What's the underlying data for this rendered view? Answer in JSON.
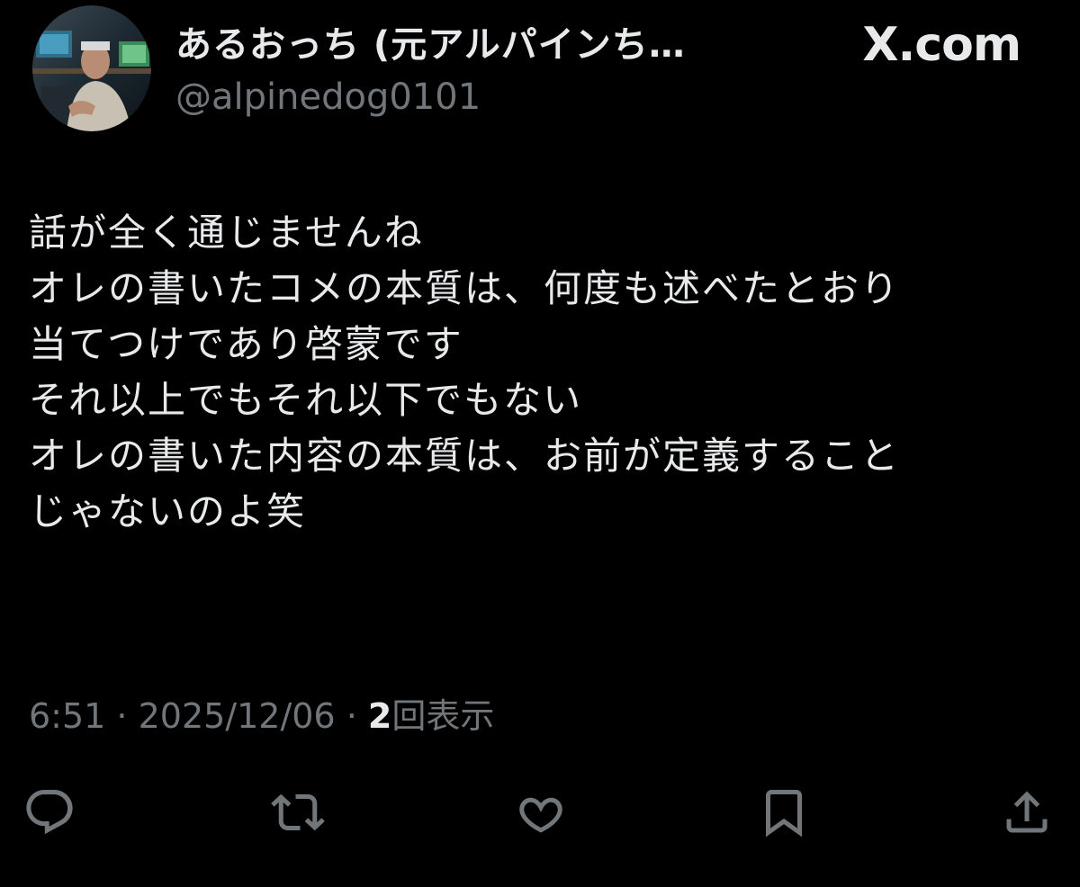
{
  "header": {
    "display_name": "あるおっち (元アルパインち…",
    "handle": "@alpinedog0101",
    "brand": "X.com",
    "avatar": "avatar-photo"
  },
  "tweet": {
    "lines": [
      "話が全く通じませんね",
      "オレの書いたコメの本質は、何度も述べたとおり",
      "当てつけであり啓蒙です",
      "それ以上でもそれ以下でもない",
      "オレの書いた内容の本質は、お前が定義すること",
      "じゃないのよ笑"
    ]
  },
  "meta": {
    "time": "6:51",
    "separator": " · ",
    "date": "2025/12/06",
    "views_count": "2",
    "views_label": "回表示"
  },
  "actions": {
    "reply_icon": "reply-icon",
    "repost_icon": "repost-icon",
    "like_icon": "heart-icon",
    "bookmark_icon": "bookmark-icon",
    "share_icon": "share-icon"
  },
  "colors": {
    "background": "#000000",
    "primary_text": "#e7e9ea",
    "secondary_text": "#71767b"
  }
}
